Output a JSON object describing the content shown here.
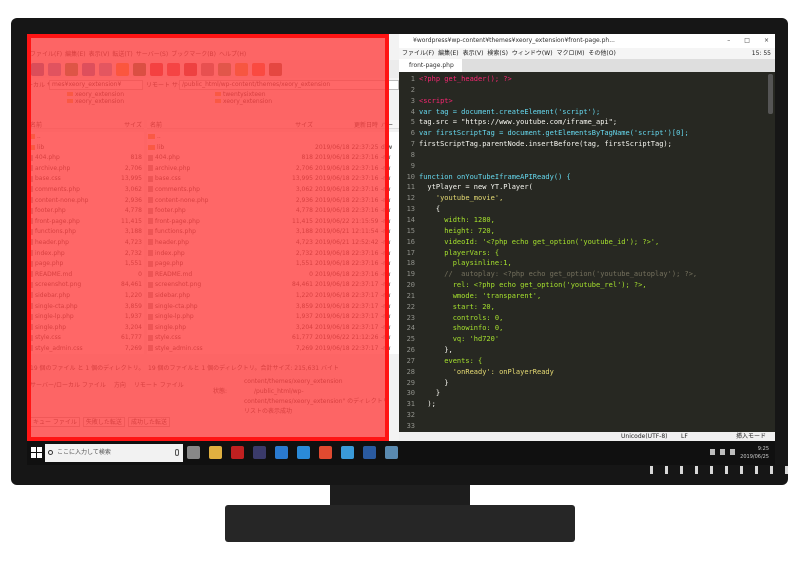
{
  "colors": {
    "overlay": "#ff1414",
    "editor_bg": "#272822",
    "code_keyword": "#66d9ef",
    "code_string": "#e6db74",
    "code_function": "#a6e22e",
    "code_tag": "#f92672",
    "comment": "#75715e"
  },
  "ftp": {
    "menu": [
      "ファイル(F)",
      "編集(E)",
      "表示(V)",
      "転送(T)",
      "サーバー(S)",
      "ブックマーク(B)",
      "ヘルプ(H)"
    ],
    "toolbar_icons": [
      "site-manager-icon",
      "message-log-icon",
      "local-tree-icon",
      "remote-tree-icon",
      "queue-icon",
      "refresh-icon",
      "process-queue-icon",
      "cancel-icon",
      "disconnect-icon",
      "reconnect-icon",
      "filter-icon",
      "compare-icon",
      "search-icon",
      "sync-browse-icon",
      "find-icon"
    ],
    "local_site_label": "ーカル サイト:",
    "local_site_value": "mes¥xeory_extension¥",
    "remote_site_label": "リモート サイト:",
    "remote_site_value": "/public_html/wp-content/themes/xeory_extension",
    "local_tree": [
      "xeory_extension",
      "xeory_extension"
    ],
    "remote_tree": [
      "twentysixteen",
      "xeory_extension"
    ],
    "local_headers": {
      "name": "名前",
      "size": "サイズ"
    },
    "remote_headers": {
      "name": "名前",
      "size": "サイズ",
      "date": "更新日時",
      "perm": "パー"
    },
    "local_files": [
      {
        "name": "..",
        "size": ""
      },
      {
        "name": "lib",
        "size": ""
      },
      {
        "name": "404.php",
        "size": "818"
      },
      {
        "name": "archive.php",
        "size": "2,706"
      },
      {
        "name": "base.css",
        "size": "13,995"
      },
      {
        "name": "comments.php",
        "size": "3,062"
      },
      {
        "name": "content-none.php",
        "size": "2,936"
      },
      {
        "name": "footer.php",
        "size": "4,778"
      },
      {
        "name": "front-page.php",
        "size": "11,415"
      },
      {
        "name": "functions.php",
        "size": "3,188"
      },
      {
        "name": "header.php",
        "size": "4,723"
      },
      {
        "name": "index.php",
        "size": "2,732"
      },
      {
        "name": "page.php",
        "size": "1,551"
      },
      {
        "name": "README.md",
        "size": "0"
      },
      {
        "name": "screenshot.png",
        "size": "84,461"
      },
      {
        "name": "sidebar.php",
        "size": "1,220"
      },
      {
        "name": "single-cta.php",
        "size": "3,859"
      },
      {
        "name": "single-lp.php",
        "size": "1,937"
      },
      {
        "name": "single.php",
        "size": "3,204"
      },
      {
        "name": "style.css",
        "size": "61,777"
      },
      {
        "name": "style_admin.css",
        "size": "7,269"
      }
    ],
    "remote_files": [
      {
        "name": "..",
        "size": "",
        "date": "",
        "perm": ""
      },
      {
        "name": "lib",
        "size": "",
        "date": "2019/06/18 22:37:25",
        "perm": "drw"
      },
      {
        "name": "404.php",
        "size": "818",
        "date": "2019/06/18 22:37:16",
        "perm": "-rw"
      },
      {
        "name": "archive.php",
        "size": "2,706",
        "date": "2019/06/18 22:37:16",
        "perm": "-rw"
      },
      {
        "name": "base.css",
        "size": "13,995",
        "date": "2019/06/18 22:37:16",
        "perm": "-rw"
      },
      {
        "name": "comments.php",
        "size": "3,062",
        "date": "2019/06/18 22:37:16",
        "perm": "-rw"
      },
      {
        "name": "content-none.php",
        "size": "2,936",
        "date": "2019/06/18 22:37:16",
        "perm": "-rw"
      },
      {
        "name": "footer.php",
        "size": "4,778",
        "date": "2019/06/18 22:37:16",
        "perm": "-rw"
      },
      {
        "name": "front-page.php",
        "size": "11,415",
        "date": "2019/06/22 21:15:59",
        "perm": "-rw"
      },
      {
        "name": "functions.php",
        "size": "3,188",
        "date": "2019/06/21 12:11:54",
        "perm": "-rw"
      },
      {
        "name": "header.php",
        "size": "4,723",
        "date": "2019/06/21 12:52:42",
        "perm": "-rw"
      },
      {
        "name": "index.php",
        "size": "2,732",
        "date": "2019/06/18 22:37:16",
        "perm": "-rw"
      },
      {
        "name": "page.php",
        "size": "1,551",
        "date": "2019/06/18 22:37:16",
        "perm": "-rw"
      },
      {
        "name": "README.md",
        "size": "0",
        "date": "2019/06/18 22:37:16",
        "perm": "-rw"
      },
      {
        "name": "screenshot.png",
        "size": "84,461",
        "date": "2019/06/18 22:37:17",
        "perm": "-rw"
      },
      {
        "name": "sidebar.php",
        "size": "1,220",
        "date": "2019/06/18 22:37:17",
        "perm": "-rw"
      },
      {
        "name": "single-cta.php",
        "size": "3,859",
        "date": "2019/06/18 22:37:17",
        "perm": "-rw"
      },
      {
        "name": "single-lp.php",
        "size": "1,937",
        "date": "2019/06/18 22:37:17",
        "perm": "-rw"
      },
      {
        "name": "single.php",
        "size": "3,204",
        "date": "2019/06/18 22:37:17",
        "perm": "-rw"
      },
      {
        "name": "style.css",
        "size": "61,777",
        "date": "2019/06/22 21:12:26",
        "perm": "-rw"
      },
      {
        "name": "style_admin.css",
        "size": "7,269",
        "date": "2019/06/18 22:37:17",
        "perm": "-rw"
      }
    ],
    "local_status": "19 個のファイル と 1 個のディレクトリ。合計",
    "remote_status": "19 個のファイルと 1 個のディレクトリ。合計サイズ: 215,631 バイト",
    "queue_headers": [
      "サーバー/ローカル ファイル",
      "方向",
      "リモート ファイル"
    ],
    "log_line1": "content/themes/xeory_extension",
    "log_label": "状態:",
    "log_line2": "/public_html/wp-",
    "log_line3": "content/themes/xeory_extension\" のディレクトリ",
    "log_line4": "リストの表示成功",
    "queue_tabs": [
      "キュー ファイル",
      "失敗した転送",
      "成功した転送"
    ]
  },
  "editor": {
    "title": "¥wordpress¥wp-content¥themes¥xeory_extension¥front-page.ph...",
    "window_buttons": [
      "–",
      "□",
      "×"
    ],
    "menu": [
      "ファイル(F)",
      "編集(E)",
      "表示(V)",
      "検索(S)",
      "ウィンドウ(W)",
      "マクロ(M)",
      "その他(O)"
    ],
    "clock": "15: 55",
    "tab": "front-page.php",
    "lines": [
      "1",
      "2",
      "3",
      "4",
      "5",
      "6",
      "7",
      "8",
      "9",
      "10",
      "11",
      "12",
      "13",
      "14",
      "15",
      "16",
      "17",
      "18",
      "19",
      "20",
      "21",
      "22",
      "23",
      "24",
      "25",
      "26",
      "27",
      "28",
      "29",
      "30",
      "31",
      "32",
      "33"
    ],
    "code": [
      "<?php get_header(); ?>",
      "",
      "<script>",
      "var tag = document.createElement('script');",
      "tag.src = \"https://www.youtube.com/iframe_api\";",
      "var firstScriptTag = document.getElementsByTagName('script')[0];",
      "firstScriptTag.parentNode.insertBefore(tag, firstScriptTag);",
      "",
      "",
      "function onYouTubeIframeAPIReady() {",
      "  ytPlayer = new YT.Player(",
      "    'youtube_movie',",
      "    {",
      "      width: 1280,",
      "      height: 720,",
      "      videoId: '<?php echo get_option('youtube_id'); ?>',",
      "      playerVars: {",
      "        playsinline:1,",
      "      //  autoplay: <?php echo get_option('youtube_autoplay'); ?>,",
      "        rel: <?php echo get_option('youtube_rel'); ?>,",
      "        wmode: 'transparent',",
      "        start: 20,",
      "        controls: 0,",
      "        showinfo: 0,",
      "        vq: 'hd720'",
      "      },",
      "      events: {",
      "        'onReady': onPlayerReady",
      "      }",
      "    }",
      "  );",
      "",
      ""
    ],
    "status_encoding": "Unicode(UTF-8)",
    "status_eol": "LF",
    "status_mode": "挿入モード"
  },
  "taskbar": {
    "search_placeholder": "ここに入力して検索",
    "apps": [
      "task-view-icon",
      "file-explorer-icon",
      "filezilla-icon",
      "terminal-icon",
      "store-icon",
      "edge-icon",
      "chrome-icon",
      "photos-icon",
      "code-editor-icon",
      "remote-desktop-icon"
    ],
    "time": "9:25",
    "date": "2019/06/25"
  }
}
